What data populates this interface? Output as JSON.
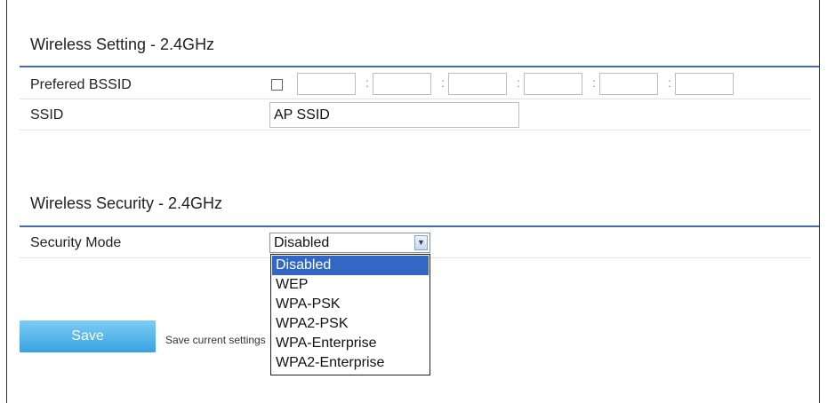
{
  "wireless_setting": {
    "title": "Wireless Setting - 2.4GHz",
    "bssid": {
      "label": "Prefered BSSID",
      "enabled": false,
      "octets": [
        "",
        "",
        "",
        "",
        "",
        ""
      ],
      "separator": ":"
    },
    "ssid": {
      "label": "SSID",
      "value": "AP SSID"
    }
  },
  "wireless_security": {
    "title": "Wireless Security - 2.4GHz",
    "mode": {
      "label": "Security Mode",
      "selected": "Disabled",
      "options": [
        "Disabled",
        "WEP",
        "WPA-PSK",
        "WPA2-PSK",
        "WPA-Enterprise",
        "WPA2-Enterprise"
      ],
      "highlighted_index": 0,
      "arrow_glyph": "▼"
    }
  },
  "actions": {
    "save_label": "Save",
    "save_description": "Save current settings"
  },
  "colors": {
    "accent": "#4a6aa3",
    "button": "#37a3e2",
    "highlight": "#3367c6"
  }
}
